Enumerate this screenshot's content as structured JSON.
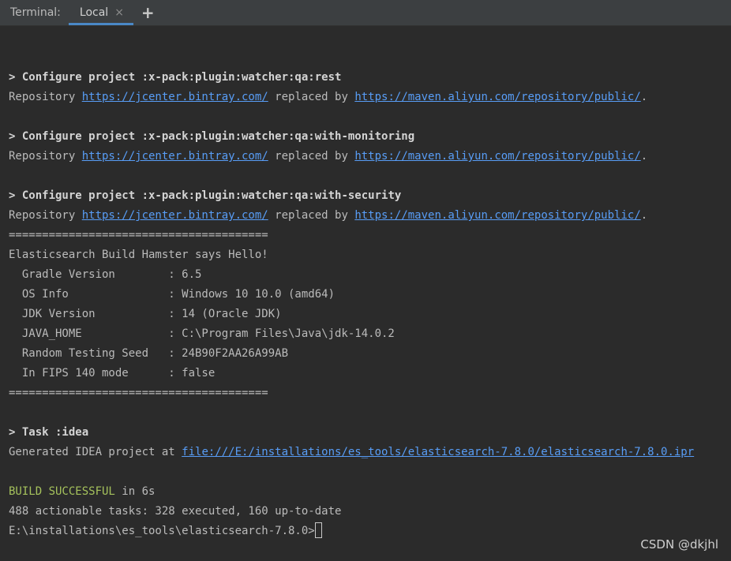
{
  "tabbar": {
    "label": "Terminal:",
    "tab_local": "Local",
    "close_glyph": "×",
    "add_glyph": "+"
  },
  "lines": [
    {
      "t": "cfg",
      "prefix": "> ",
      "text": "Configure project :x-pack:plugin:watcher:qa:rest"
    },
    {
      "t": "repo",
      "a": "Repository ",
      "u1": "https://jcenter.bintray.com/",
      "b": " replaced by ",
      "u2": "https://maven.aliyun.com/repository/public/",
      "c": "."
    },
    {
      "t": "blank"
    },
    {
      "t": "cfg",
      "prefix": "> ",
      "text": "Configure project :x-pack:plugin:watcher:qa:with-monitoring"
    },
    {
      "t": "repo",
      "a": "Repository ",
      "u1": "https://jcenter.bintray.com/",
      "b": " replaced by ",
      "u2": "https://maven.aliyun.com/repository/public/",
      "c": "."
    },
    {
      "t": "blank"
    },
    {
      "t": "cfg",
      "prefix": "> ",
      "text": "Configure project :x-pack:plugin:watcher:qa:with-security"
    },
    {
      "t": "repo",
      "a": "Repository ",
      "u1": "https://jcenter.bintray.com/",
      "b": " replaced by ",
      "u2": "https://maven.aliyun.com/repository/public/",
      "c": "."
    },
    {
      "t": "plain",
      "text": "======================================="
    },
    {
      "t": "plain",
      "text": "Elasticsearch Build Hamster says Hello!"
    },
    {
      "t": "plain",
      "text": "  Gradle Version        : 6.5"
    },
    {
      "t": "plain",
      "text": "  OS Info               : Windows 10 10.0 (amd64)"
    },
    {
      "t": "plain",
      "text": "  JDK Version           : 14 (Oracle JDK)"
    },
    {
      "t": "plain",
      "text": "  JAVA_HOME             : C:\\Program Files\\Java\\jdk-14.0.2"
    },
    {
      "t": "plain",
      "text": "  Random Testing Seed   : 24B90F2AA26A99AB"
    },
    {
      "t": "plain",
      "text": "  In FIPS 140 mode      : false"
    },
    {
      "t": "plain",
      "text": "======================================="
    },
    {
      "t": "blank"
    },
    {
      "t": "cfg",
      "prefix": "> ",
      "text": "Task :idea"
    },
    {
      "t": "gen",
      "a": "Generated IDEA project at ",
      "u1": "file:///E:/installations/es_tools/elasticsearch-7.8.0/elasticsearch-7.8.0.ipr"
    },
    {
      "t": "blank"
    },
    {
      "t": "build",
      "a": "BUILD SUCCESSFUL",
      "b": " in 6s"
    },
    {
      "t": "plain",
      "text": "488 actionable tasks: 328 executed, 160 up-to-date"
    },
    {
      "t": "prompt",
      "text": "E:\\installations\\es_tools\\elasticsearch-7.8.0>"
    }
  ],
  "watermark": "CSDN @dkjhl"
}
